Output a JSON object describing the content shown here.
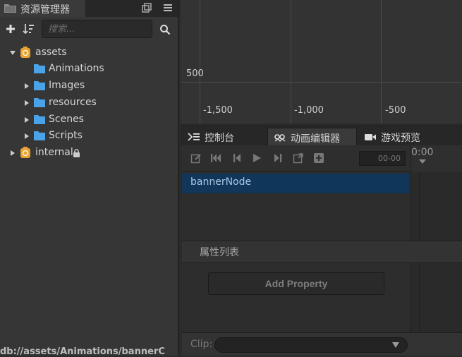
{
  "explorer": {
    "title": "资源管理器",
    "search_placeholder": "搜索...",
    "tree": [
      {
        "label": "assets"
      },
      {
        "label": "Animations"
      },
      {
        "label": "Images"
      },
      {
        "label": "resources"
      },
      {
        "label": "Scenes"
      },
      {
        "label": "Scripts"
      },
      {
        "label": "internal"
      }
    ],
    "status_path": "db://assets/Animations/bannerC"
  },
  "scene": {
    "y_label": "500",
    "x_labels": [
      "-1,500",
      "-1,000",
      "-500"
    ]
  },
  "bottom_tabs": [
    {
      "label": "控制台"
    },
    {
      "label": "动画编辑器"
    },
    {
      "label": "游戏预览"
    }
  ],
  "animation": {
    "time_value": "00-00",
    "timeline_start": "0:00",
    "node_name": "bannerNode",
    "property_list_title": "属性列表",
    "add_property_label": "Add Property",
    "clip_label": "Clip:",
    "clip_value": ""
  },
  "colors": {
    "folder_blue": "#4aa3e8",
    "asset_db_orange": "#e8a332",
    "selected_row": "#10365a"
  }
}
